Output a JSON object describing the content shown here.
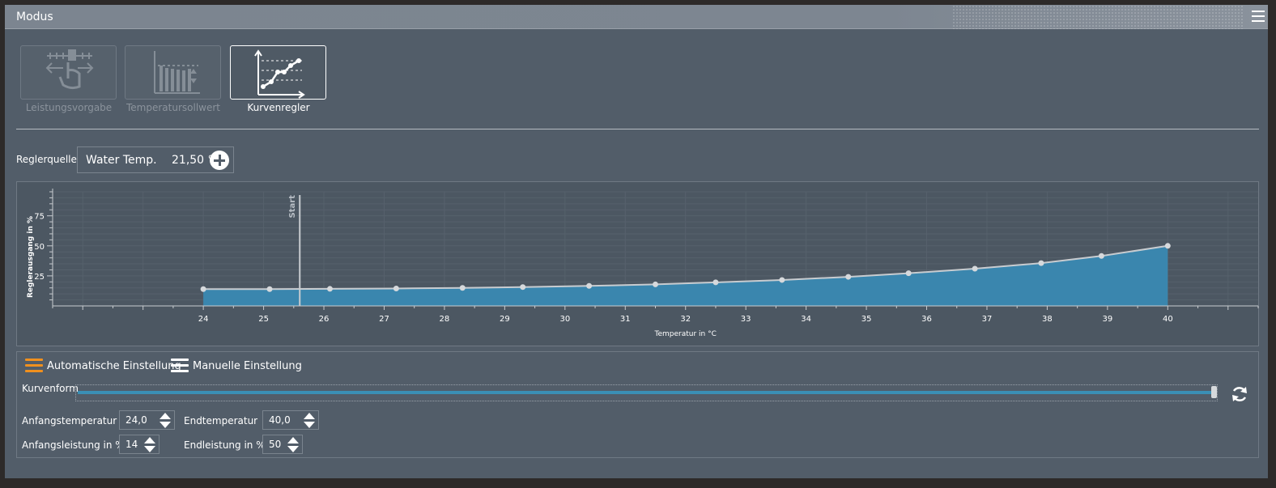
{
  "window": {
    "title": "Modus"
  },
  "modes": [
    {
      "label": "Leistungsvorgabe",
      "active": false
    },
    {
      "label": "Temperatursollwert",
      "active": false
    },
    {
      "label": "Kurvenregler",
      "active": true
    }
  ],
  "source": {
    "label": "Reglerquelle",
    "name": "Water Temp.",
    "value": "21,50 °C"
  },
  "chart_data": {
    "type": "area",
    "xlabel": "Temperatur in °C",
    "ylabel": "Reglerausgang in %",
    "xlim": [
      21.5,
      41.5
    ],
    "ylim": [
      0,
      95
    ],
    "x_ticks": [
      24,
      25,
      26,
      27,
      28,
      29,
      30,
      31,
      32,
      33,
      34,
      35,
      36,
      37,
      38,
      39,
      40
    ],
    "y_ticks": [
      25,
      50,
      75
    ],
    "x": [
      24,
      25.1,
      26.1,
      27.2,
      28.3,
      29.3,
      30.4,
      31.5,
      32.5,
      33.6,
      34.7,
      35.7,
      36.8,
      37.9,
      38.9,
      40
    ],
    "values": [
      14,
      14,
      14.2,
      14.5,
      15,
      15.7,
      16.7,
      17.9,
      19.6,
      21.6,
      24.2,
      27.2,
      31,
      35.6,
      41.6,
      50
    ],
    "start_marker": {
      "label": "Start",
      "x": 25.6
    },
    "grid": true,
    "colors": {
      "fill": "#3a86ae",
      "line": "#c8ccd0",
      "point": "#d6d9dc"
    }
  },
  "controls": {
    "auto_label": "Automatische Einstellung",
    "manual_label": "Manuelle Einstellung",
    "selected": "auto",
    "curve_label": "Kurvenform",
    "curve_value": 1.0,
    "start_temp_label": "Anfangstemperatur",
    "start_temp": "24,0",
    "end_temp_label": "Endtemperatur",
    "end_temp": "40,0",
    "start_power_label": "Anfangsleistung in %",
    "start_power": "14",
    "end_power_label": "Endleistung in %",
    "end_power": "50"
  },
  "colors": {
    "accent": "#f0901e",
    "panel": "#525d69",
    "fill": "#3a86ae"
  }
}
